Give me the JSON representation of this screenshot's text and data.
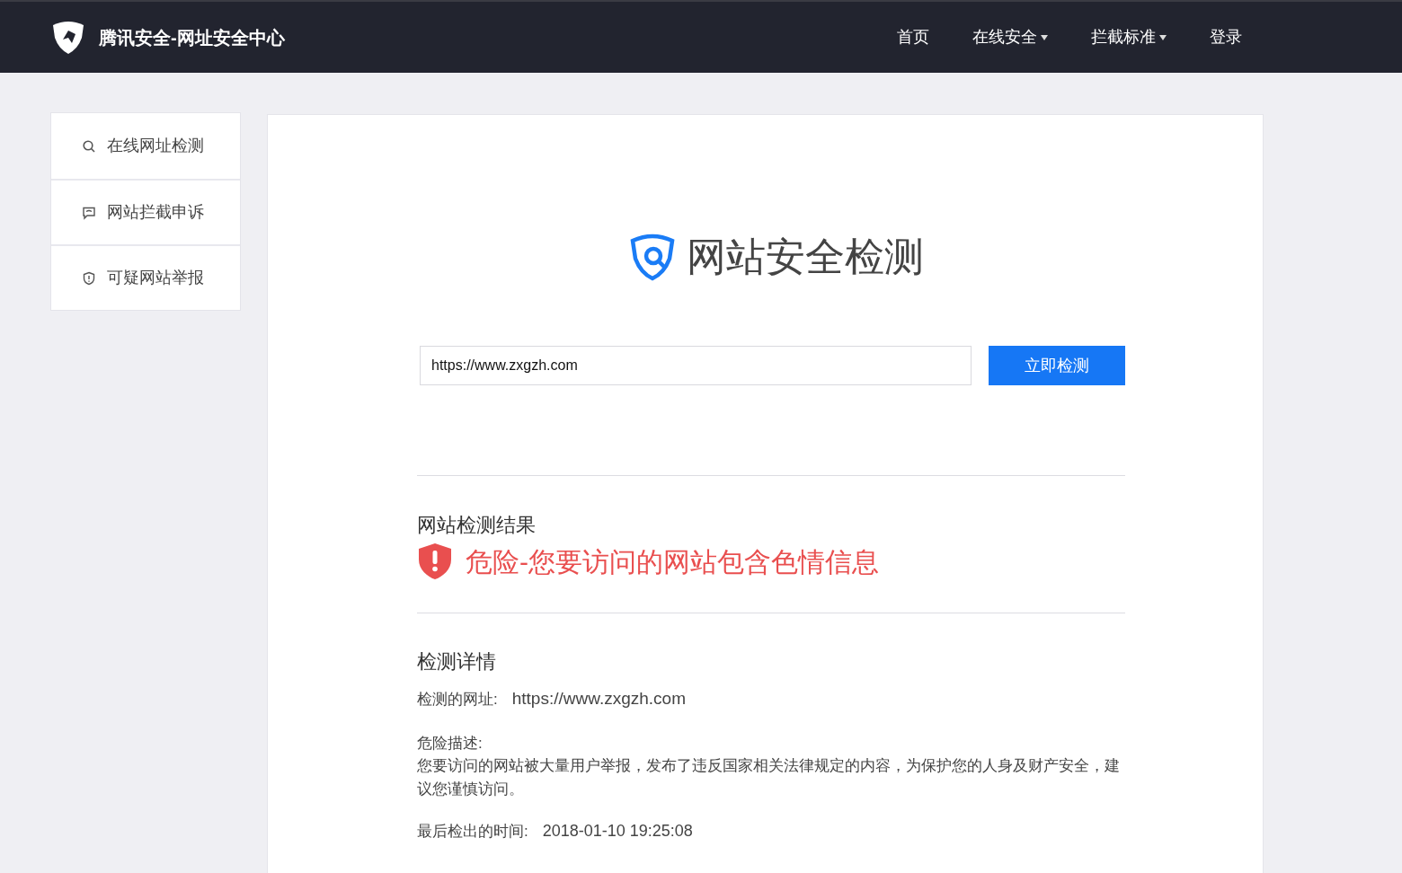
{
  "header": {
    "title": "腾讯安全-网址安全中心",
    "nav": [
      {
        "label": "首页",
        "dropdown": false
      },
      {
        "label": "在线安全",
        "dropdown": true
      },
      {
        "label": "拦截标准",
        "dropdown": true
      },
      {
        "label": "登录",
        "dropdown": false
      }
    ]
  },
  "sidebar": {
    "items": [
      {
        "kind": "search",
        "label": "在线网址检测"
      },
      {
        "kind": "comment",
        "label": "网站拦截申诉"
      },
      {
        "kind": "report",
        "label": "可疑网站举报"
      }
    ]
  },
  "checker": {
    "title": "网站安全检测",
    "url_field": {
      "value": "https://www.zxgzh.com"
    },
    "button": "立即检测"
  },
  "result": {
    "heading": "网站检测结果",
    "kind": "danger",
    "color": "#e94f4f",
    "message": "危险-您要访问的网站包含色情信息"
  },
  "details": {
    "heading": "检测详情",
    "url_label": "检测的网址:",
    "url": "https://www.zxgzh.com",
    "description_label": "危险描述:",
    "description": "您要访问的网站被大量用户举报，发布了违反国家相关法律规定的内容，为保护您的人身及财产安全，建议您谨慎访问。",
    "time_label": "最后检出的时间:",
    "time": "2018-01-10 19:25:08"
  }
}
